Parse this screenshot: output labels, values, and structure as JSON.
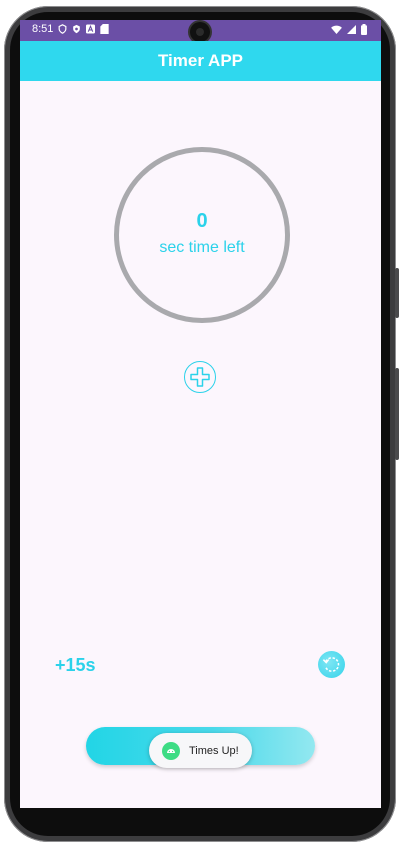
{
  "status_bar": {
    "time": "8:51",
    "left_icons": [
      "vpn-shield-icon",
      "play-protect-icon",
      "a-icon",
      "sd-card-icon"
    ],
    "right_icons": [
      "wifi-icon",
      "cellular-signal-icon",
      "battery-icon"
    ]
  },
  "app_bar": {
    "title": "Timer APP"
  },
  "timer": {
    "count": "0",
    "caption": "sec time left"
  },
  "actions": {
    "add_icon": "plus-circle-icon",
    "increment_label": "+15s",
    "reset_icon": "reset-icon"
  },
  "toast": {
    "message": "Times Up!",
    "icon": "android-icon"
  },
  "colors": {
    "status_bar": "#6b4fa6",
    "app_bar": "#2fd8ee",
    "accent": "#2bd2ea",
    "background": "#fcf6fd",
    "ring": "#a9a9ad"
  }
}
